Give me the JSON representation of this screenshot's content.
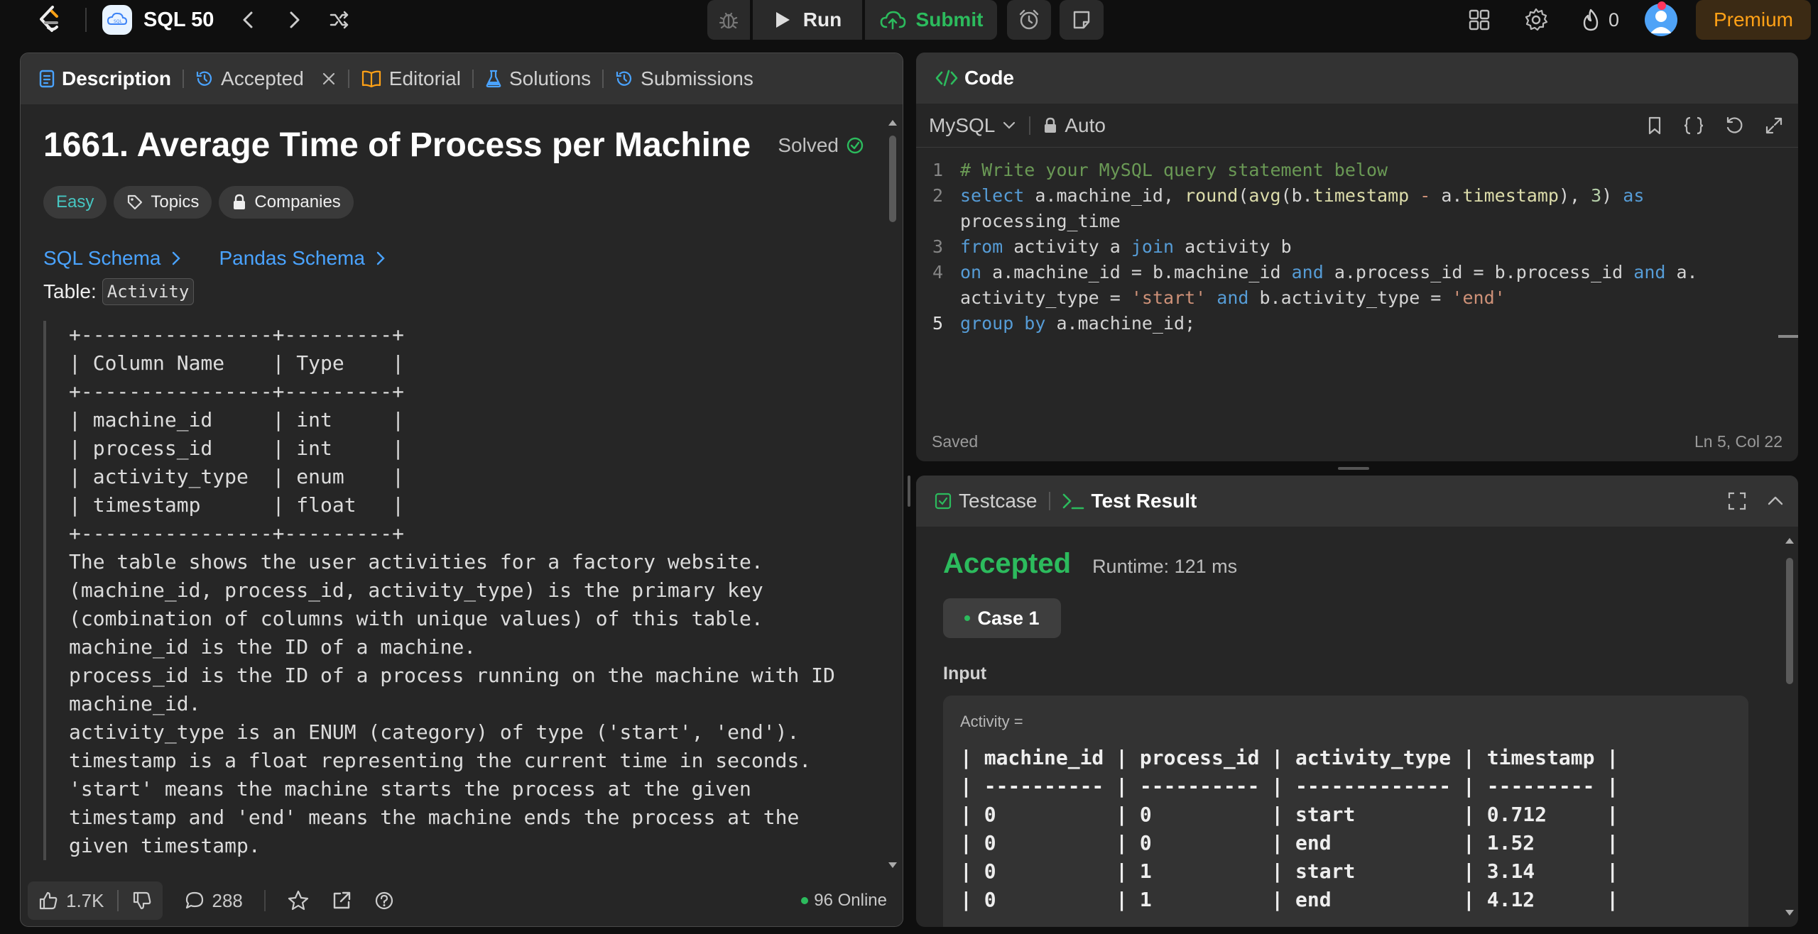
{
  "nav": {
    "list_title": "SQL 50",
    "run_label": "Run",
    "submit_label": "Submit",
    "streak": "0",
    "premium_label": "Premium"
  },
  "left_panel": {
    "tabs": [
      {
        "label": "Description"
      },
      {
        "label": "Accepted"
      },
      {
        "label": "Editorial"
      },
      {
        "label": "Solutions"
      },
      {
        "label": "Submissions"
      }
    ],
    "title": "1661. Average Time of Process per Machine",
    "solved_label": "Solved",
    "chips": {
      "difficulty": "Easy",
      "topics": "Topics",
      "companies": "Companies"
    },
    "links": {
      "sql_schema": "SQL Schema",
      "pandas_schema": "Pandas Schema"
    },
    "table_prefix": "Table:",
    "table_name": "Activity",
    "schema_text": "+----------------+---------+\n| Column Name    | Type    |\n+----------------+---------+\n| machine_id     | int     |\n| process_id     | int     |\n| activity_type  | enum    |\n| timestamp      | float   |\n+----------------+---------+\nThe table shows the user activities for a factory website.\n(machine_id, process_id, activity_type) is the primary key\n(combination of columns with unique values) of this table.\nmachine_id is the ID of a machine.\nprocess_id is the ID of a process running on the machine with ID\nmachine_id.\nactivity_type is an ENUM (category) of type ('start', 'end').\ntimestamp is a float representing the current time in seconds.\n'start' means the machine starts the process at the given\ntimestamp and 'end' means the machine ends the process at the\ngiven timestamp.",
    "likes": "1.7K",
    "comments": "288",
    "online": "96 Online"
  },
  "code_panel": {
    "header": "Code",
    "language": "MySQL",
    "mode": "Auto",
    "line_numbers": [
      "1",
      "2",
      "",
      "3",
      "4",
      "",
      "5"
    ],
    "status_left": "Saved",
    "status_right": "Ln 5, Col 22"
  },
  "result_panel": {
    "tabs": [
      {
        "label": "Testcase"
      },
      {
        "label": "Test Result"
      }
    ],
    "status": "Accepted",
    "runtime": "Runtime: 121 ms",
    "case_label": "Case 1",
    "input_label": "Input",
    "var_name": "Activity =",
    "table_text": "| machine_id | process_id | activity_type | timestamp |\n| ---------- | ---------- | ------------- | --------- |\n| 0          | 0          | start         | 0.712     |\n| 0          | 0          | end           | 1.52      |\n| 0          | 1          | start         | 3.14      |\n| 0          | 1          | end           | 4.12      |"
  },
  "colors": {
    "accent_green": "#2cbb5d",
    "brand_orange": "#ffa116",
    "link_blue": "#4aa3ff",
    "easy_teal": "#46c6c2"
  },
  "icons": [
    "leetcode-logo",
    "list-icon",
    "chevron-left-icon",
    "chevron-right-icon",
    "shuffle-icon",
    "bug-icon",
    "play-icon",
    "cloud-upload-icon",
    "alarm-icon",
    "note-icon",
    "grid-icon",
    "gear-icon",
    "fire-icon",
    "avatar",
    "document-icon",
    "history-icon",
    "close-icon",
    "book-icon",
    "flask-icon",
    "tag-icon",
    "lock-icon",
    "thumb-up-icon",
    "thumb-down-icon",
    "comment-icon",
    "star-icon",
    "share-icon",
    "help-icon",
    "bookmark-icon",
    "braces-icon",
    "undo-icon",
    "expand-icon",
    "checkbox-icon",
    "terminal-icon",
    "fullscreen-icon",
    "chevron-up-icon",
    "code-icon"
  ]
}
